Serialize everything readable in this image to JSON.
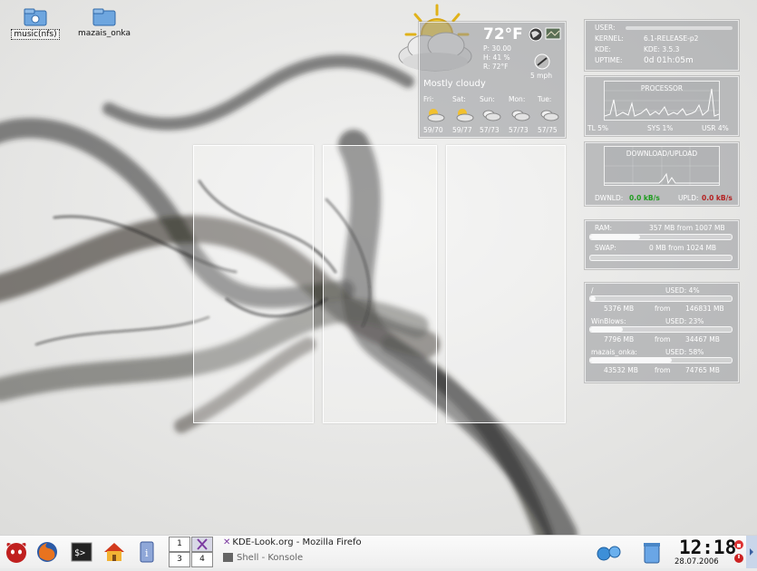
{
  "desktop_icons": [
    {
      "label": "music(nfs)",
      "selected": true
    },
    {
      "label": "mazais_onka",
      "selected": false
    }
  ],
  "weather": {
    "temp": "72°F",
    "pressure": "P: 30.00",
    "humidity": "H: 41 %",
    "realfeel": "R: 72°F",
    "wind": "5 mph",
    "condition": "Mostly cloudy",
    "forecast": [
      {
        "day": "Fri:",
        "range": "59/70",
        "icon": "partly-sunny-icon"
      },
      {
        "day": "Sat:",
        "range": "59/77",
        "icon": "partly-sunny-icon"
      },
      {
        "day": "Sun:",
        "range": "57/73",
        "icon": "cloudy-icon"
      },
      {
        "day": "Mon:",
        "range": "57/73",
        "icon": "cloudy-icon"
      },
      {
        "day": "Tue:",
        "range": "57/75",
        "icon": "cloudy-icon"
      }
    ]
  },
  "sysinfo": {
    "user_label": "USER:",
    "kernel_label": "KERNEL:",
    "kernel": "6.1-RELEASE-p2",
    "kde_label": "KDE:",
    "kde": "KDE: 3.5.3",
    "uptime_label": "UPTIME:",
    "uptime": "0d 01h:05m"
  },
  "processor": {
    "title": "PROCESSOR",
    "tl": "TL 5%",
    "sys": "SYS 1%",
    "usr": "USR 4%"
  },
  "network": {
    "title": "DOWNLOAD/UPLOAD",
    "down_label": "DWNLD:",
    "down": "0.0 kB/s",
    "up_label": "UPLD:",
    "up": "0.0 kB/s"
  },
  "memory": {
    "ram_label": "RAM:",
    "ram": "357 MB from 1007 MB",
    "ram_fraction": 0.35,
    "swap_label": "SWAP:",
    "swap": "0 MB from 1024 MB",
    "swap_fraction": 0.0
  },
  "disks": [
    {
      "name": "/",
      "used": "USED: 4%",
      "used_mb": "5376 MB",
      "from": "from",
      "total_mb": "146831 MB",
      "fraction": 0.04
    },
    {
      "name": "WinBlows:",
      "used": "USED: 23%",
      "used_mb": "7796 MB",
      "from": "from",
      "total_mb": "34467 MB",
      "fraction": 0.23
    },
    {
      "name": "mazais_onka:",
      "used": "USED: 58%",
      "used_mb": "43532 MB",
      "from": "from",
      "total_mb": "74765 MB",
      "fraction": 0.58
    }
  ],
  "pager": [
    "1",
    "2",
    "3",
    "4"
  ],
  "tasks": [
    {
      "label": "KDE-Look.org - Mozilla Firefo",
      "icon": "firefox-x-icon"
    },
    {
      "label": "Shell - Konsole",
      "icon": "konsole-icon"
    }
  ],
  "clock": {
    "time": "12:18",
    "date": "28.07.2006"
  }
}
